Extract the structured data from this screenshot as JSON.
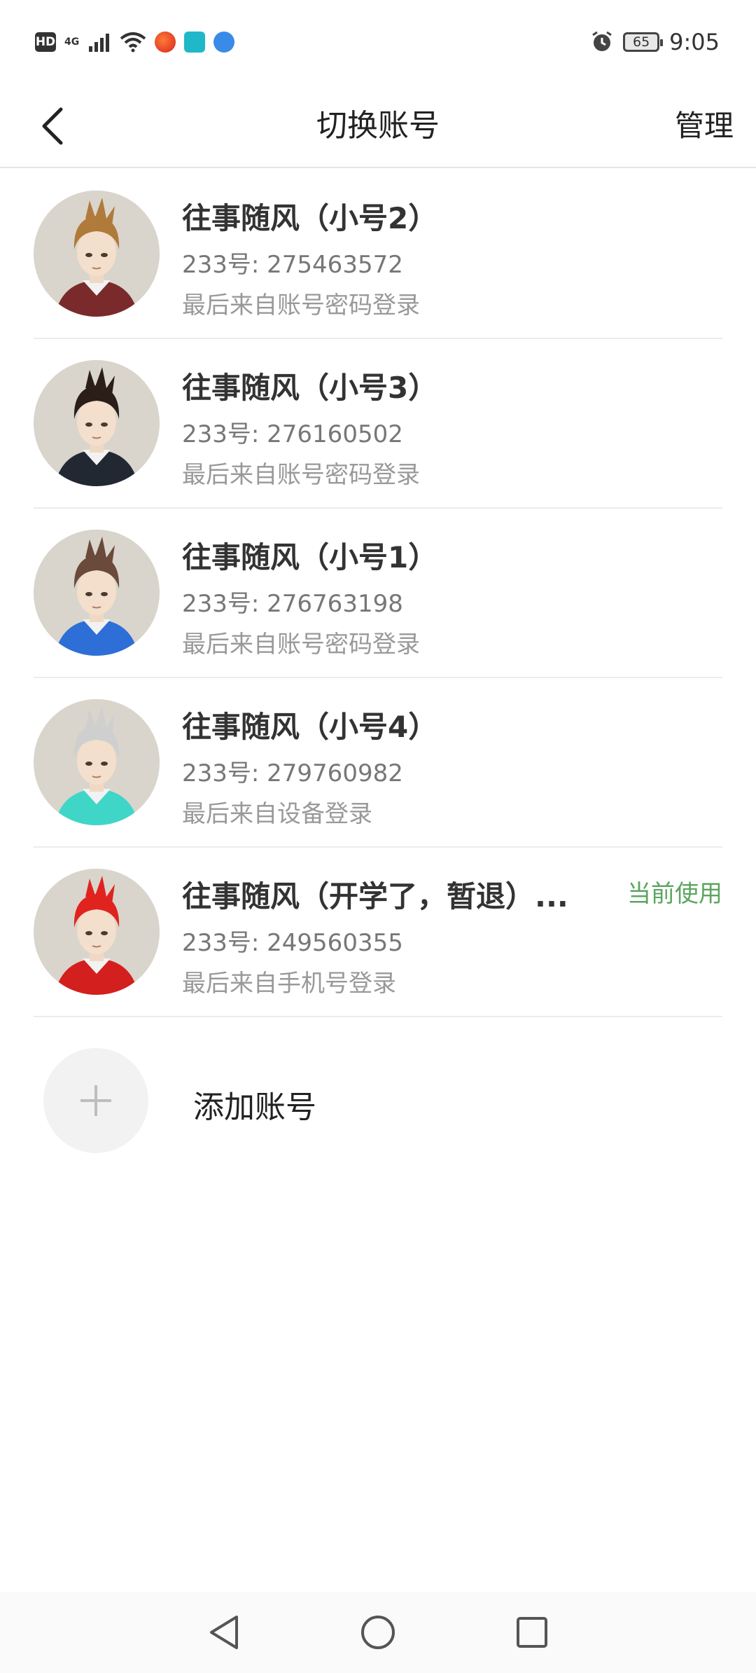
{
  "status_bar": {
    "hd": "HD",
    "network": "4G",
    "battery": "65",
    "time": "9:05",
    "icons": [
      "hd-icon",
      "signal-icon",
      "wifi-icon",
      "app-icon-red",
      "app-icon-teal",
      "app-icon-blue",
      "alarm-icon",
      "battery-icon"
    ]
  },
  "header": {
    "title": "切换账号",
    "manage_label": "管理",
    "back_icon": "back-arrow-icon"
  },
  "accounts": [
    {
      "name": "往事随风（小号2）",
      "id": "233号: 275463572",
      "login": "最后来自账号密码登录",
      "hair": "#b07a3a",
      "outfit": "#7a2a2a",
      "current": ""
    },
    {
      "name": "往事随风（小号3）",
      "id": "233号: 276160502",
      "login": "最后来自账号密码登录",
      "hair": "#2b1e18",
      "outfit": "#222831",
      "current": ""
    },
    {
      "name": "往事随风（小号1）",
      "id": "233号: 276763198",
      "login": "最后来自账号密码登录",
      "hair": "#6a4a3a",
      "outfit": "#2d6fd6",
      "current": ""
    },
    {
      "name": "往事随风（小号4）",
      "id": "233号: 279760982",
      "login": "最后来自设备登录",
      "hair": "#cfcfcf",
      "outfit": "#3fd6c8",
      "current": ""
    },
    {
      "name": "往事随风（开学了，暂退）...",
      "id": "233号: 249560355",
      "login": "最后来自手机号登录",
      "hair": "#e0231e",
      "outfit": "#d41f1f",
      "current": "当前使用"
    }
  ],
  "add_account": {
    "label": "添加账号",
    "icon": "plus-icon"
  },
  "colors": {
    "current_tag": "#5aa65f",
    "divider": "#ececec"
  },
  "system_nav": [
    "back-triangle-icon",
    "home-circle-icon",
    "recents-square-icon"
  ]
}
